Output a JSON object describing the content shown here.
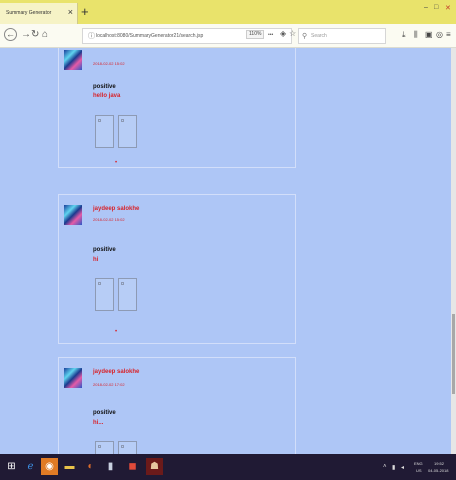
{
  "browser": {
    "tab_title": "Summary Generator",
    "tab_close": "×",
    "new_tab": "+",
    "window_controls": {
      "minimize": "–",
      "maximize": "□",
      "close": "✕"
    },
    "url": "localhost:8080/SummaryGenerator21/search.jsp",
    "zoom": "110%",
    "more": "•••",
    "search_placeholder": "Search"
  },
  "posts": [
    {
      "user": "",
      "date": "2018-02-02 15:02",
      "sentiment": "positive",
      "comment": "hello java"
    },
    {
      "user": "jaydeep salokhe",
      "date": "2018-02-02 15:02",
      "sentiment": "positive",
      "comment": "hi"
    },
    {
      "user": "jaydeep salokhe",
      "date": "2018-02-02 17:02",
      "sentiment": "positive",
      "comment": "hi..."
    }
  ],
  "separator_dot": "•",
  "taskbar": {
    "language": "ENG",
    "region": "US",
    "time": "19:52",
    "date": "04-05-2018"
  },
  "colors": {
    "page_bg": "#aec6f6",
    "accent_red": "#d8232a",
    "tabbar": "#e9e36b",
    "taskbar": "#201a34"
  }
}
